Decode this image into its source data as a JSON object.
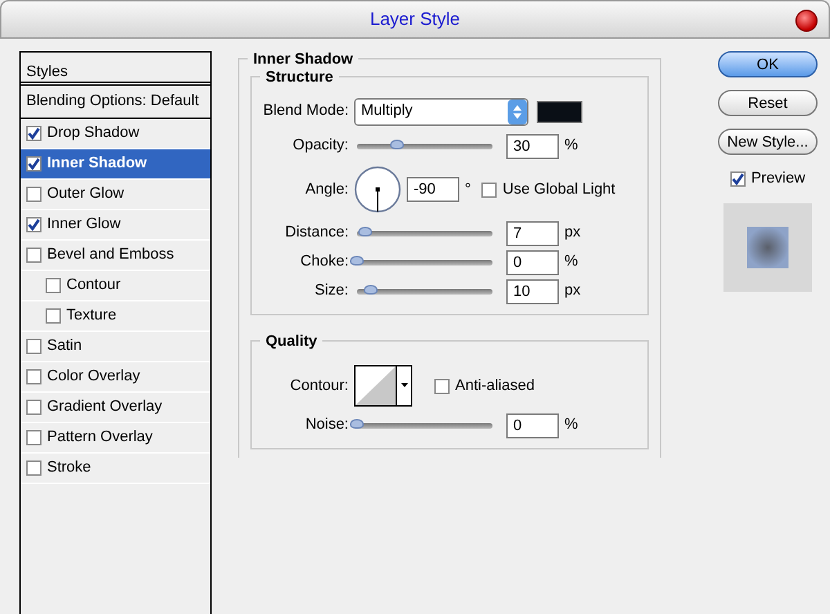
{
  "window": {
    "title": "Layer Style"
  },
  "sidebar": {
    "header": "Styles",
    "items": [
      {
        "kind": "plain",
        "label": "Blending Options: Default",
        "selected": false
      },
      {
        "kind": "checkbox",
        "label": "Drop Shadow",
        "checked": true,
        "selected": false
      },
      {
        "kind": "checkbox",
        "label": "Inner Shadow",
        "checked": true,
        "selected": true
      },
      {
        "kind": "checkbox",
        "label": "Outer Glow",
        "checked": false,
        "selected": false
      },
      {
        "kind": "checkbox",
        "label": "Inner Glow",
        "checked": true,
        "selected": false
      },
      {
        "kind": "checkbox",
        "label": "Bevel and Emboss",
        "checked": false,
        "selected": false,
        "children": [
          {
            "kind": "checkbox",
            "label": "Contour",
            "checked": false,
            "selected": false
          },
          {
            "kind": "checkbox",
            "label": "Texture",
            "checked": false,
            "selected": false
          }
        ]
      },
      {
        "kind": "checkbox",
        "label": "Satin",
        "checked": false,
        "selected": false
      },
      {
        "kind": "checkbox",
        "label": "Color Overlay",
        "checked": false,
        "selected": false
      },
      {
        "kind": "checkbox",
        "label": "Gradient Overlay",
        "checked": false,
        "selected": false
      },
      {
        "kind": "checkbox",
        "label": "Pattern Overlay",
        "checked": false,
        "selected": false
      },
      {
        "kind": "checkbox",
        "label": "Stroke",
        "checked": false,
        "selected": false
      }
    ]
  },
  "panel": {
    "title": "Inner Shadow",
    "structure": {
      "title": "Structure",
      "blend_mode": {
        "label": "Blend Mode:",
        "value": "Multiply",
        "color": "#0a0f16"
      },
      "opacity": {
        "label": "Opacity:",
        "level": 0.3,
        "value": "30",
        "unit": "%"
      },
      "angle": {
        "label": "Angle:",
        "value": "-90",
        "unit": "°",
        "global_light": {
          "label": "Use Global Light",
          "checked": false
        }
      },
      "distance": {
        "label": "Distance:",
        "level": 0.06,
        "value": "7",
        "unit": "px"
      },
      "choke": {
        "label": "Choke:",
        "level": 0,
        "value": "0",
        "unit": "%"
      },
      "size": {
        "label": "Size:",
        "level": 0.1,
        "value": "10",
        "unit": "px"
      }
    },
    "quality": {
      "title": "Quality",
      "contour": {
        "label": "Contour:",
        "anti_aliased": {
          "label": "Anti-aliased",
          "checked": false
        }
      },
      "noise": {
        "label": "Noise:",
        "level": 0,
        "value": "0",
        "unit": "%"
      }
    }
  },
  "buttons": [
    {
      "label": "OK",
      "default": true
    },
    {
      "label": "Reset",
      "default": false
    },
    {
      "label": "New Style...",
      "default": false
    }
  ],
  "preview": {
    "label": "Preview",
    "checked": true
  }
}
